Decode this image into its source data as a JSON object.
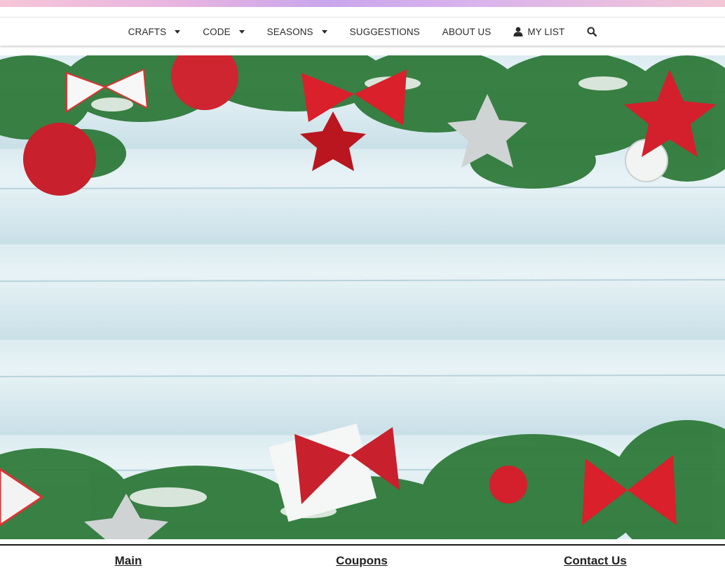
{
  "nav": {
    "items": [
      {
        "label": "CRAFTS",
        "has_dropdown": true
      },
      {
        "label": "CODE",
        "has_dropdown": true
      },
      {
        "label": "SEASONS",
        "has_dropdown": true
      },
      {
        "label": "SUGGESTIONS",
        "has_dropdown": false
      },
      {
        "label": "ABOUT US",
        "has_dropdown": false
      }
    ],
    "my_list_label": "MY LIST",
    "icons": {
      "my_list": "user-icon",
      "search": "search-icon",
      "dropdown": "caret-down-icon"
    }
  },
  "hero": {
    "image": "christmas-fir-branches-ornaments-on-wooden-boards"
  },
  "footer": {
    "columns": [
      "Main",
      "Coupons",
      "Contact Us"
    ]
  },
  "colors": {
    "nav_text": "#2b2b2b",
    "ornament_red": "#d21f2b",
    "fir_green": "#2f7a3a",
    "board": "#e2eff3"
  }
}
